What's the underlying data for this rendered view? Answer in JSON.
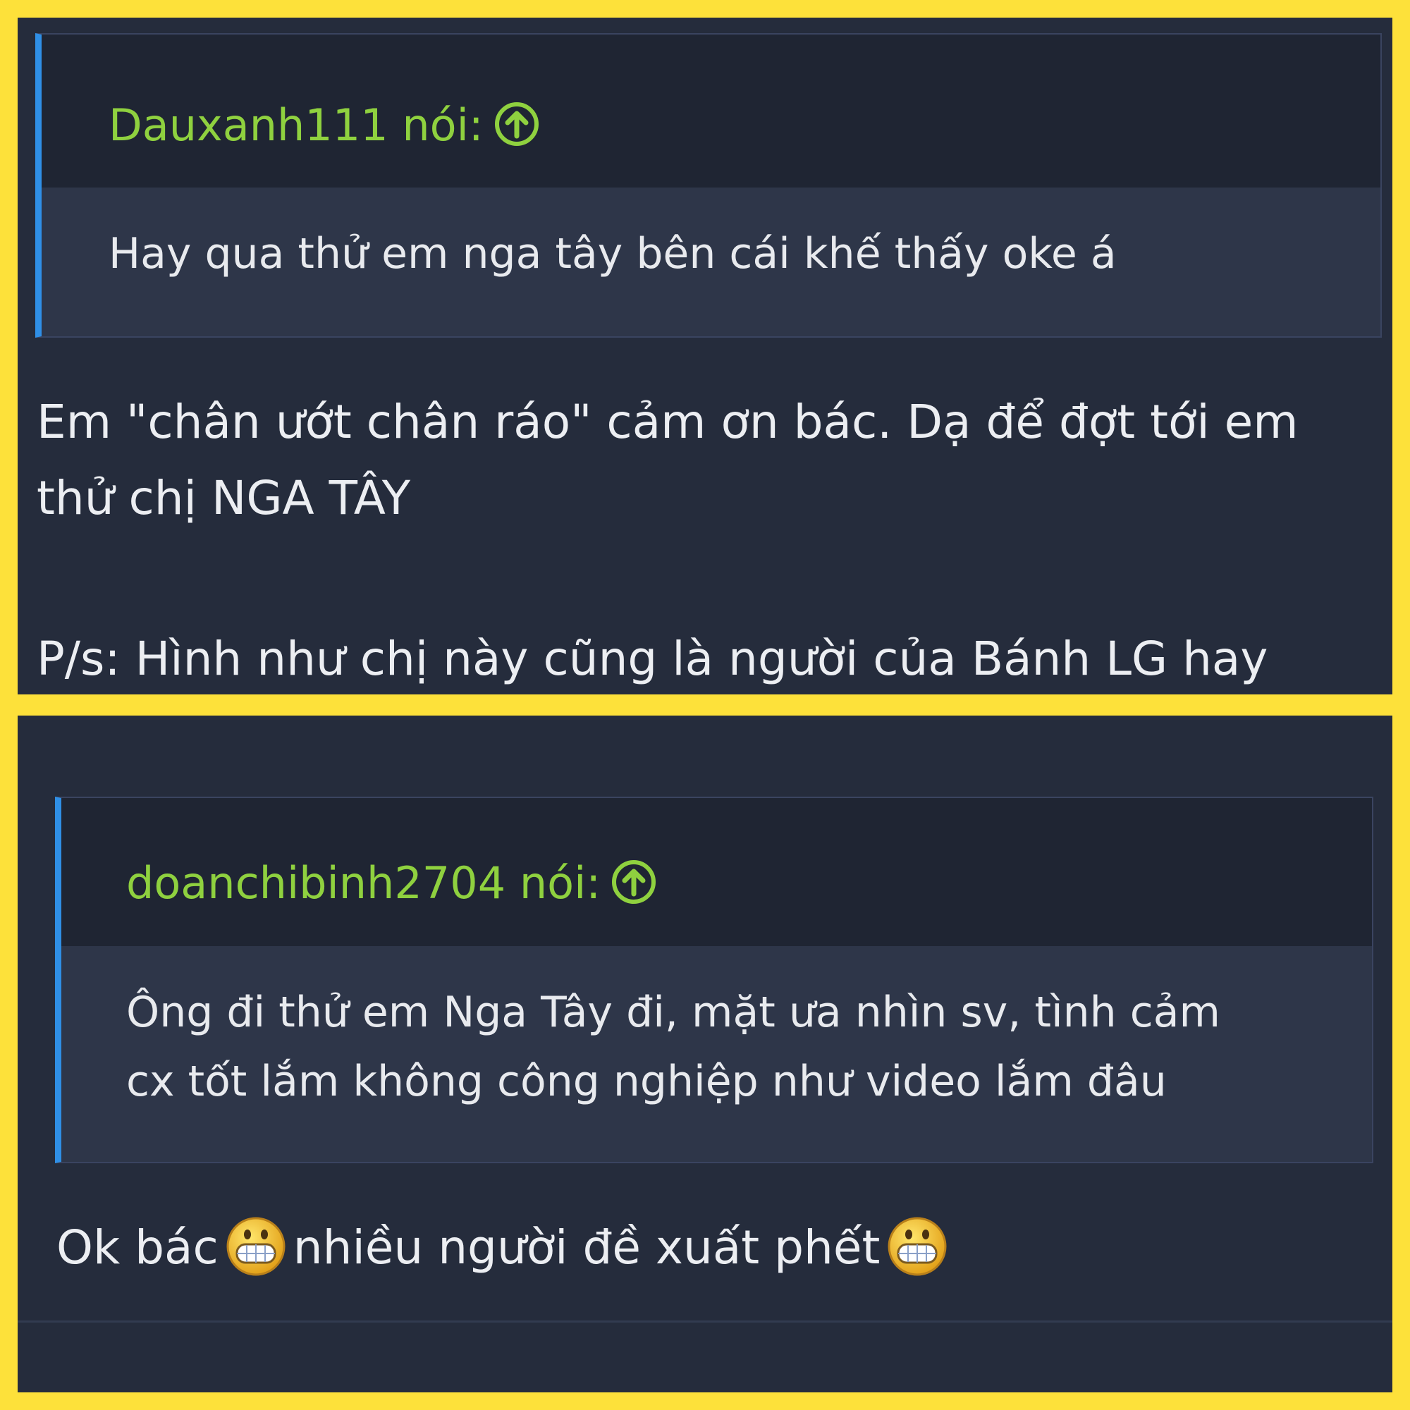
{
  "posts": [
    {
      "quote": {
        "author": "Dauxanh111 nói:",
        "lines": [
          "Hay qua thử em nga tây bên cái khế thấy oke á"
        ]
      },
      "lines": [
        "Em \"chân ướt chân ráo\" cảm ơn bác. Dạ để đợt tới em",
        "thử chị NGA TÂY",
        "P/s: Hình như chị này cũng là người của Bánh LG hay"
      ]
    },
    {
      "quote": {
        "author": "doanchibinh2704 nói:",
        "lines": [
          "Ông đi thử em Nga Tây đi, mặt ưa nhìn sv, tình cảm",
          "cx tốt lắm không công nghiệp như video lắm đâu"
        ]
      },
      "reply": {
        "part1": "Ok bác",
        "part2": "nhiều người đề xuất phết"
      }
    }
  ],
  "icons": {
    "jump_to_quote": "arrow-up-circle-icon",
    "emoji": "grinning-smiley-icon"
  },
  "colors": {
    "frame": "#fde13a",
    "background": "#252c3c",
    "quote_background": "#2e3649",
    "quote_header": "#1f2533",
    "quote_accent": "#2f8fe6",
    "author": "#8fd13f",
    "text": "#eceef2"
  }
}
